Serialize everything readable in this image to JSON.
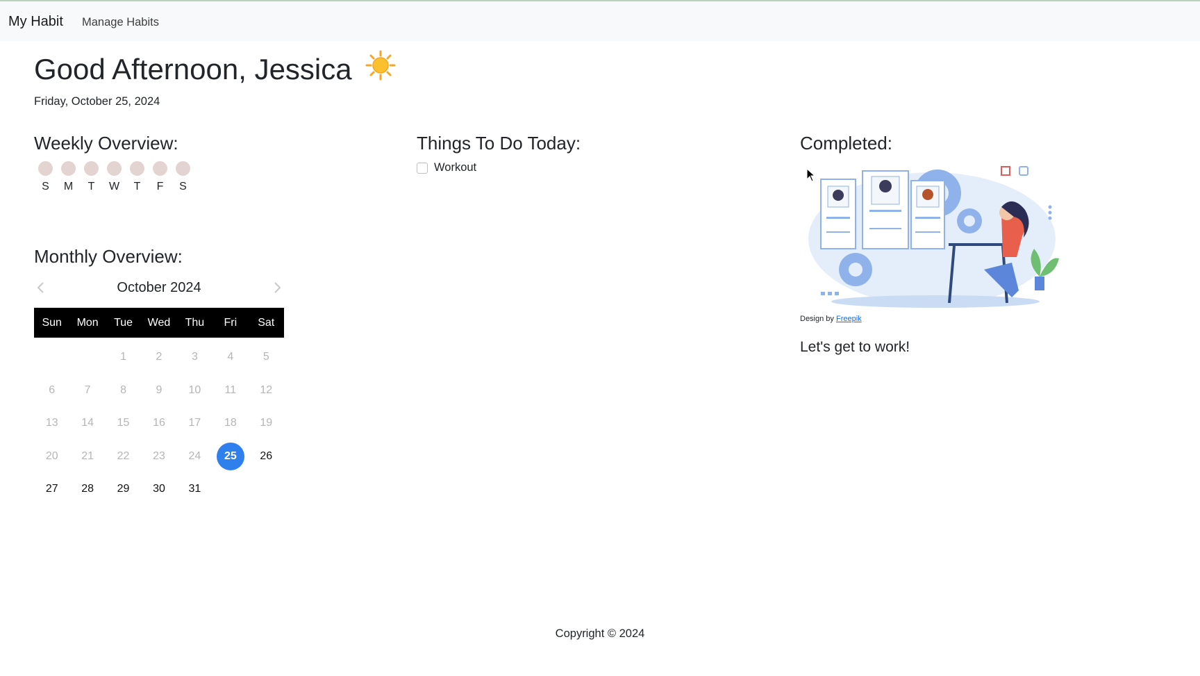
{
  "nav": {
    "brand": "My Habit",
    "link": "Manage Habits"
  },
  "greeting": {
    "text": "Good Afternoon, Jessica",
    "icon": "sun-icon",
    "date": "Friday, October 25, 2024"
  },
  "weekly": {
    "title": "Weekly Overview:",
    "days": [
      "S",
      "M",
      "T",
      "W",
      "T",
      "F",
      "S"
    ]
  },
  "monthly": {
    "title": "Monthly Overview:",
    "month_label": "October 2024",
    "weekdays": [
      "Sun",
      "Mon",
      "Tue",
      "Wed",
      "Thu",
      "Fri",
      "Sat"
    ],
    "first_weekday": 2,
    "days_in_month": 31,
    "today": 25
  },
  "todo": {
    "title": "Things To Do Today:",
    "items": [
      {
        "label": "Workout",
        "checked": false
      }
    ]
  },
  "completed": {
    "title": "Completed:",
    "credit_prefix": "Design by",
    "credit_link": "Freepik",
    "message": "Let's get to work!"
  },
  "footer": {
    "text": "Copyright © 2024"
  },
  "colors": {
    "accent": "#2f80ed",
    "dot": "#e3d3d1",
    "header_bg": "#000000"
  }
}
